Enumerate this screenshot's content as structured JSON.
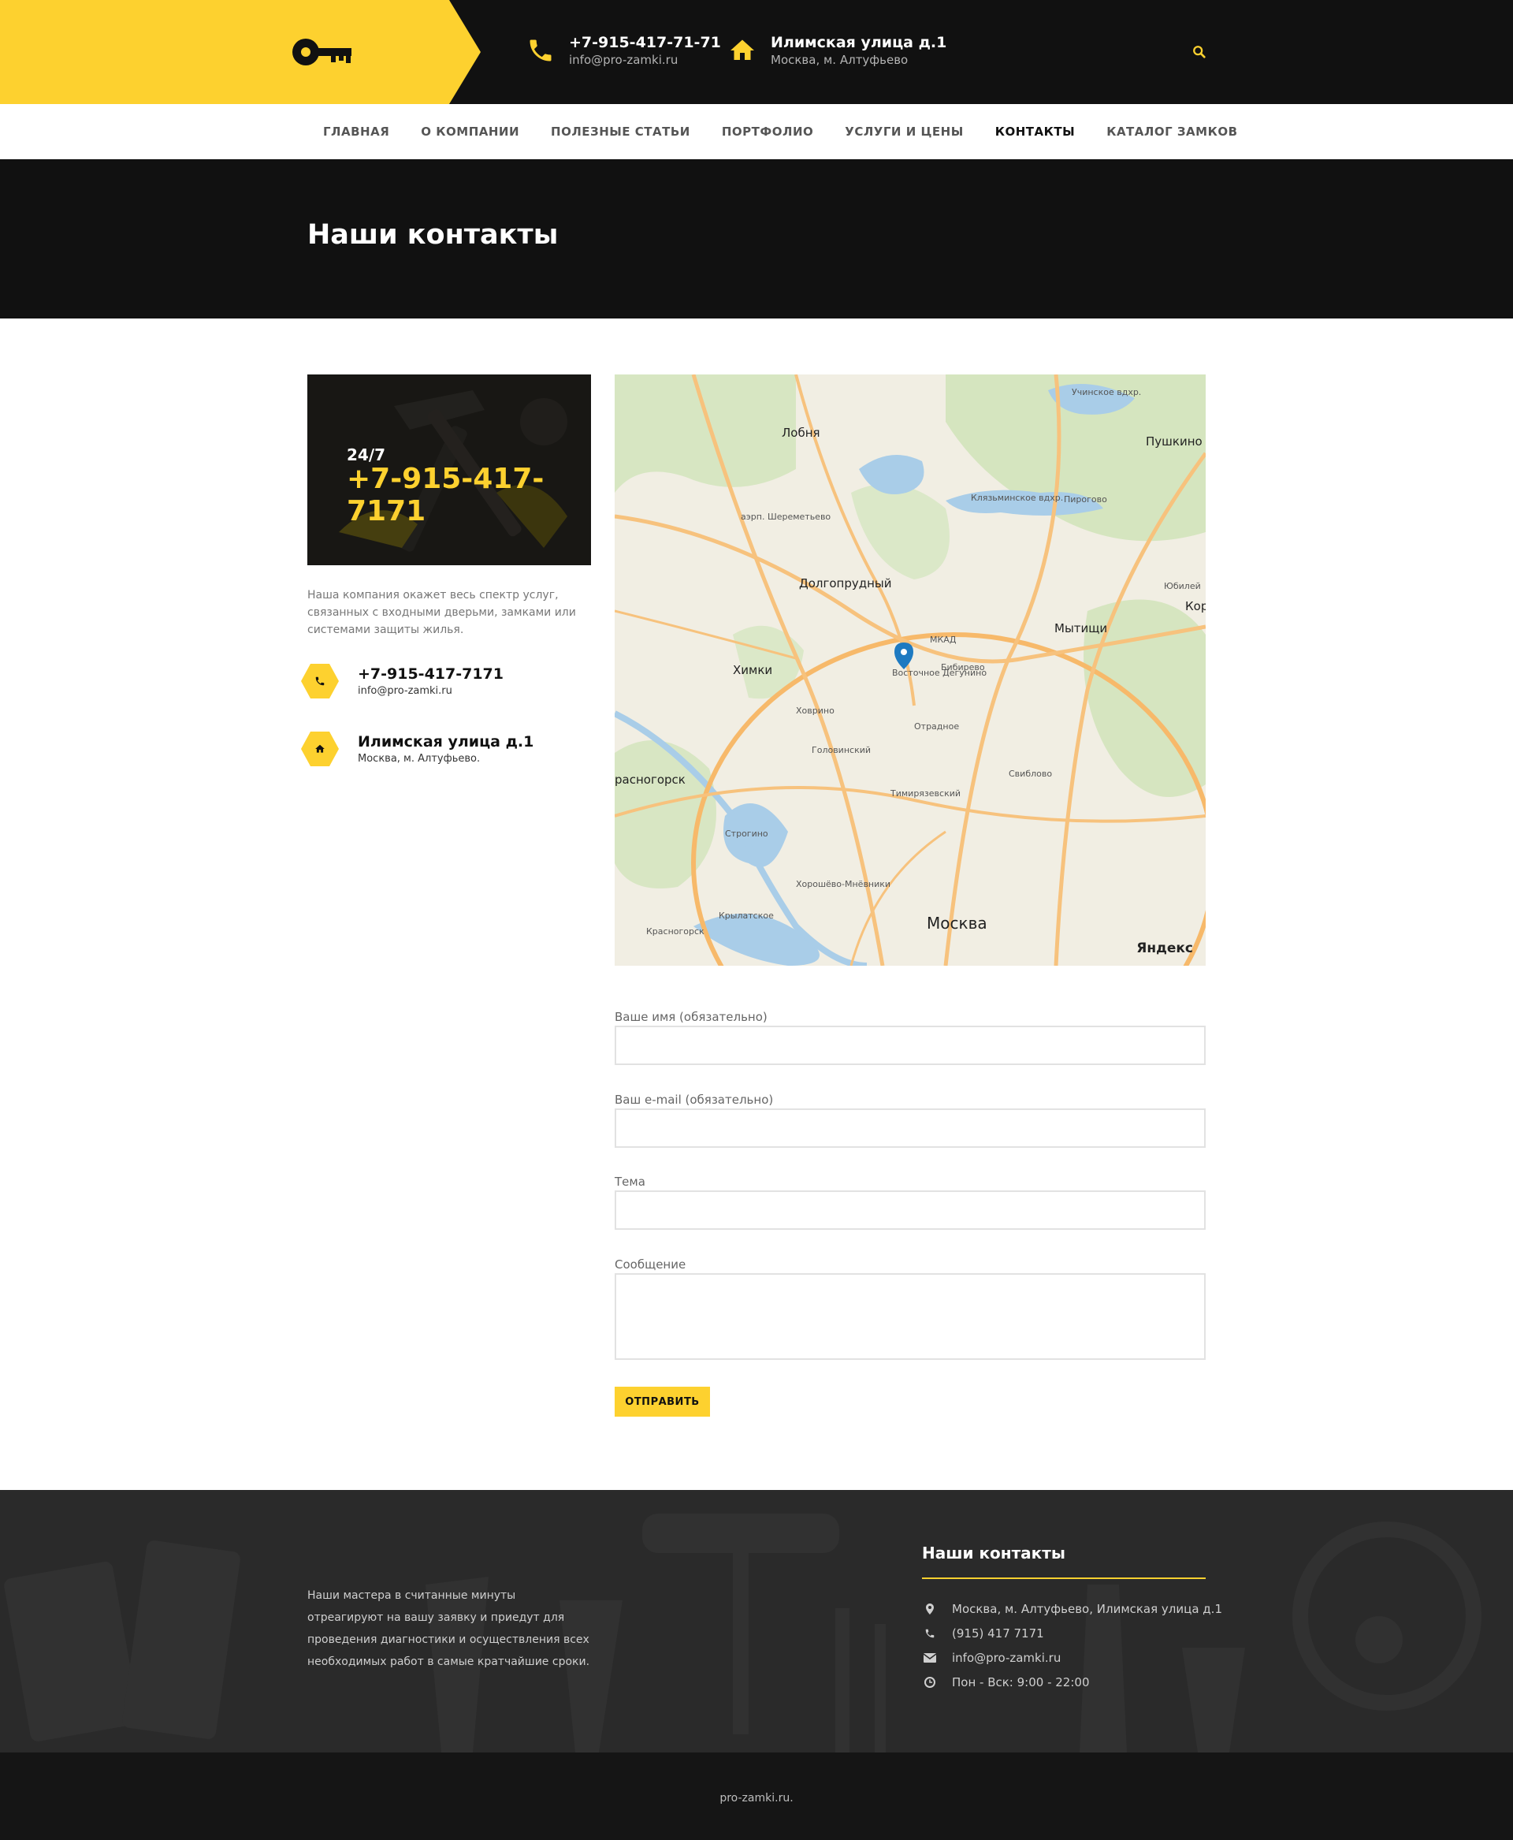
{
  "header": {
    "phone": "+7-915-417-71-71",
    "email": "info@pro-zamki.ru",
    "address": "Илимская улица д.1",
    "address_sub": "Москва, м. Алтуфьево"
  },
  "nav": {
    "items": [
      "ГЛАВНАЯ",
      "О КОМПАНИИ",
      "ПОЛЕЗНЫЕ СТАТЬИ",
      "ПОРТФОЛИО",
      "УСЛУГИ И ЦЕНЫ",
      "КОНТАКТЫ",
      "КАТАЛОГ ЗАМКОВ"
    ],
    "active": "КОНТАКТЫ"
  },
  "page_title": "Наши контакты",
  "promo": {
    "hours": "24/7",
    "phone": "+7-915-417-7171"
  },
  "about": "Наша компания окажет весь спектр услуг, связанных с входными дверьми, замками или системами защиты жилья.",
  "contacts": {
    "phone": "+7-915-417-7171",
    "email": "info@pro-zamki.ru",
    "address": "Илимская улица д.1",
    "address_sub": "Москва, м. Алтуфьево."
  },
  "map": {
    "labels": [
      "Лобня",
      "Пушкино",
      "Долгопрудный",
      "Мытищи",
      "Химки",
      "Москва",
      "расногорск",
      "Кор",
      "Юбилей",
      "аэрп. Шереметьево",
      "Восточное Дегунино",
      "Учинское вдхр.",
      "Клязьминское вдхр.",
      "Отрадное",
      "Бибирево",
      "Свиблово",
      "Строгино",
      "Хорошёво-Мнёвники",
      "Пирогово",
      "Тимирязевский",
      "Головинский",
      "Ховрино",
      "Красногорск",
      "Крылатское",
      "МКАД",
      "Яндекс"
    ]
  },
  "form": {
    "name_label": "Ваше имя (обязательно)",
    "email_label": "Ваш e-mail (обязательно)",
    "subject_label": "Тема",
    "message_label": "Сообщение",
    "submit": "ОТПРАВИТЬ"
  },
  "footer": {
    "text": "Наши мастера в считанные минуты отреагируют на вашу заявку и приедут для проведения диагностики и осуществления всех необходимых работ в самые кратчайшие сроки.",
    "heading": "Наши контакты",
    "address": "Москва, м. Алтуфьево, Илимская улица д.1",
    "phone": "(915) 417 7171",
    "email": "info@pro-zamki.ru",
    "hours": "Пон - Вск: 9:00 - 22:00",
    "copyright": "pro-zamki.ru."
  },
  "colors": {
    "accent": "#fdd12f",
    "dark": "#111111",
    "footer": "#2a2a2a"
  }
}
